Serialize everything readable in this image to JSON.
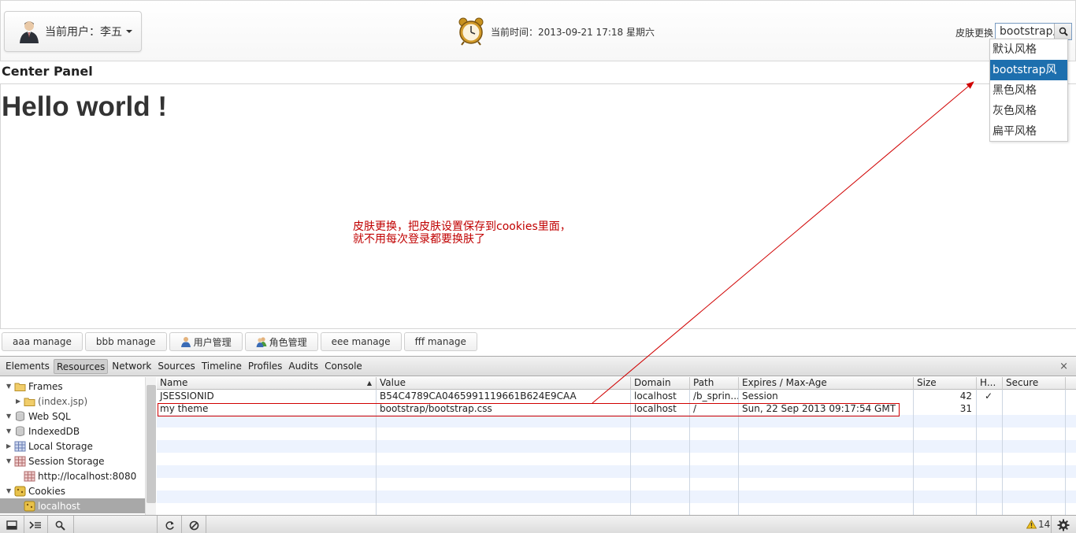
{
  "header": {
    "user_label": "当前用户：李五",
    "time_text": "当前时间：2013-09-21 17:18 星期六",
    "skin_label": "皮肤更换",
    "skin_value": "bootstrap风格"
  },
  "skin_options": [
    "默认风格",
    "bootstrap风格",
    "黑色风格",
    "灰色风格",
    "扁平风格"
  ],
  "skin_selected_index": 1,
  "center": {
    "panel_title": "Center Panel",
    "hello": "Hello world !",
    "annotation_line1": "皮肤更换，把皮肤设置保存到cookies里面，",
    "annotation_line2": "就不用每次登录都要换肤了",
    "annotation_color": "#c00000"
  },
  "tabs": [
    "aaa manage",
    "bbb manage",
    "用户管理",
    "角色管理",
    "eee manage",
    "fff manage"
  ],
  "devtools": {
    "tabs": [
      "Elements",
      "Resources",
      "Network",
      "Sources",
      "Timeline",
      "Profiles",
      "Audits",
      "Console"
    ],
    "active_tab": "Resources",
    "close_label": "×",
    "tree": {
      "frames": "Frames",
      "index": "(index.jsp)",
      "websql": "Web SQL",
      "indexeddb": "IndexedDB",
      "local_storage": "Local Storage",
      "session_storage": "Session Storage",
      "session_child": "http://localhost:8080",
      "cookies": "Cookies",
      "cookies_child": "localhost"
    },
    "columns": [
      "Name",
      "Value",
      "Domain",
      "Path",
      "Expires / Max-Age",
      "Size",
      "H...",
      "Secure"
    ],
    "rows": [
      {
        "name": "JSESSIONID",
        "value": "B54C4789CA0465991119661B624E9CAA",
        "domain": "localhost",
        "path": "/b_sprin...",
        "expires": "Session",
        "size": "42",
        "http": "✓",
        "secure": ""
      },
      {
        "name": "my theme",
        "value": "bootstrap/bootstrap.css",
        "domain": "localhost",
        "path": "/",
        "expires": "Sun, 22 Sep 2013 09:17:54 GMT",
        "size": "31",
        "http": "",
        "secure": ""
      }
    ],
    "warning_count": "14"
  },
  "colors": {
    "selected_option": "#1d6fae",
    "highlight_box": "#d00000",
    "row_stripe": "#edf3fe"
  }
}
